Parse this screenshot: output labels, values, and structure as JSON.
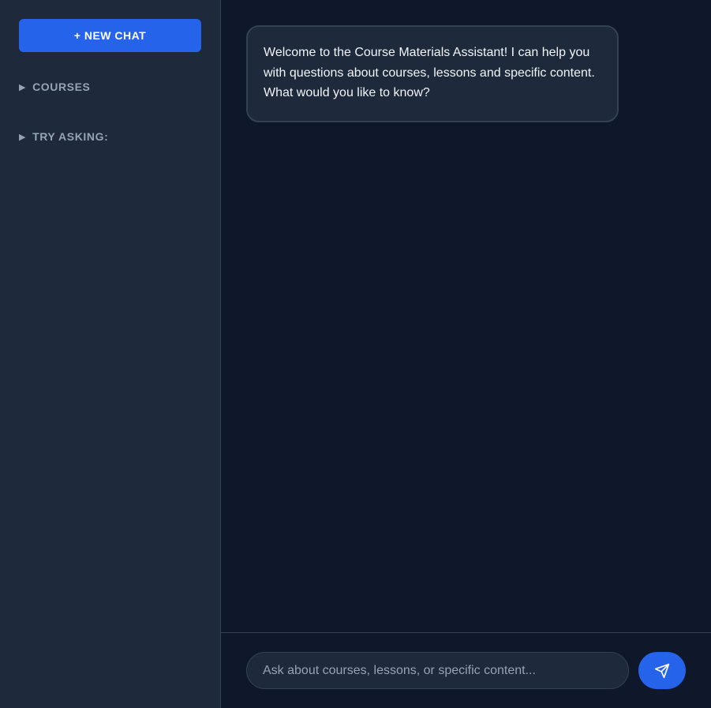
{
  "sidebar": {
    "new_chat_label": "+ NEW CHAT",
    "sections": [
      {
        "label": "COURSES",
        "icon": "caret-right-icon"
      },
      {
        "label": "TRY ASKING:",
        "icon": "caret-right-icon"
      }
    ]
  },
  "chat": {
    "messages": [
      {
        "role": "assistant",
        "text": "Welcome to the Course Materials Assistant! I can help you with questions about courses, lessons and specific content. What would you like to know?"
      }
    ]
  },
  "input": {
    "value": "",
    "placeholder": "Ask about courses, lessons, or specific content...",
    "send_icon": "send-icon"
  },
  "colors": {
    "background": "#0f172a",
    "sidebar": "#1e293b",
    "accent": "#2563eb",
    "border": "#334155",
    "muted_text": "#94a3b8",
    "text": "#f1f5f9"
  }
}
